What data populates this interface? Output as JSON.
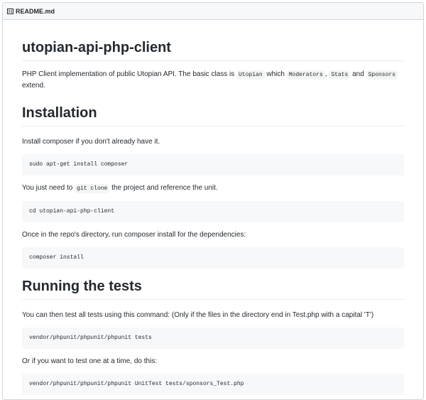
{
  "file_header": {
    "icon": "book-icon",
    "filename": "README.md"
  },
  "readme": {
    "title": "utopian-api-php-client",
    "intro": {
      "t1": "PHP Client implementation of public Utopian API. The basic class is ",
      "c1": "Utopian",
      "t2": " which ",
      "c2": "Moderators",
      "t3": ", ",
      "c3": "Stats",
      "t4": " and ",
      "c4": "Sponsors",
      "t5": "extend."
    },
    "installation": {
      "heading": "Installation",
      "p1": "Install composer if you don't already have it.",
      "code1": "sudo apt-get install composer",
      "p2_before": "You just need to ",
      "p2_code": "git clone",
      "p2_after": " the project and reference the unit.",
      "code2": "cd utopian-api-php-client",
      "p3": "Once in the repo's directory, run composer install for the dependencies:",
      "code3": "composer install"
    },
    "tests": {
      "heading": "Running the tests",
      "p1": "You can then test all tests using this command: (Only if the files in the directory end in Test.php with a capital 'T')",
      "code1": "vendor/phpunit/phpunit/phpunit tests",
      "p2": "Or if you want to test one at a time, do this:",
      "code2": "vendor/phpunit/phpunit/phpunit UnitTest tests/sponsors_Test.php"
    }
  }
}
